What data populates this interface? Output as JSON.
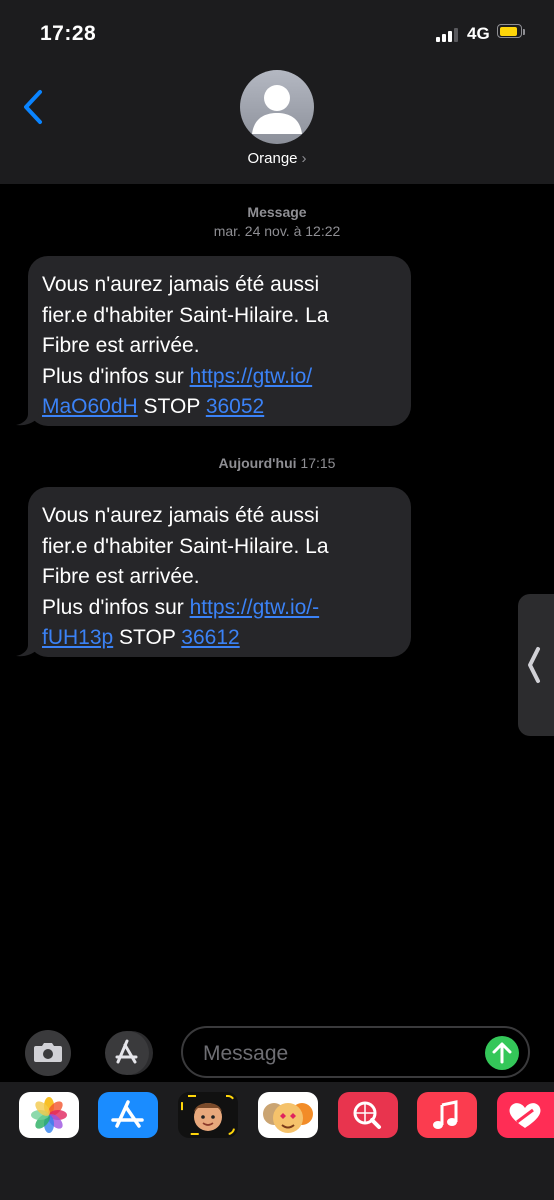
{
  "status_bar": {
    "time": "17:28",
    "network": "4G"
  },
  "header": {
    "contact_name": "Orange",
    "contact_chevron": "›"
  },
  "conversation": [
    {
      "service_label": "Message",
      "timestamp": "mar. 24 nov. à 12:22",
      "lines": [
        "Vous n'aurez jamais été aussi",
        "fier.e d'habiter Saint-Hilaire. La",
        "Fibre est arrivée."
      ],
      "info_prefix": "Plus d'infos sur ",
      "link_part1": "https://gtw.io/",
      "link_part2": "MaO60dH",
      "stop_text": " STOP ",
      "stop_number": "36052"
    },
    {
      "timestamp_day": "Aujourd'hui",
      "timestamp_time": " 17:15",
      "lines": [
        "Vous n'aurez jamais été aussi",
        "fier.e d'habiter Saint-Hilaire. La",
        "Fibre est arrivée."
      ],
      "info_prefix": "Plus d'infos sur ",
      "link_part1": "https://gtw.io/-",
      "link_part2": "fUH13p",
      "stop_text": " STOP ",
      "stop_number": "36612"
    }
  ],
  "composer": {
    "placeholder": "Message"
  },
  "app_drawer": [
    "photos-icon",
    "app-store-icon",
    "memoji-icon",
    "animoji-icon",
    "web-search-icon",
    "music-icon",
    "digital-touch-icon"
  ],
  "colors": {
    "bubble": "#262629",
    "link": "#3b82f6",
    "accent": "#0a84ff",
    "send": "#34c759"
  }
}
